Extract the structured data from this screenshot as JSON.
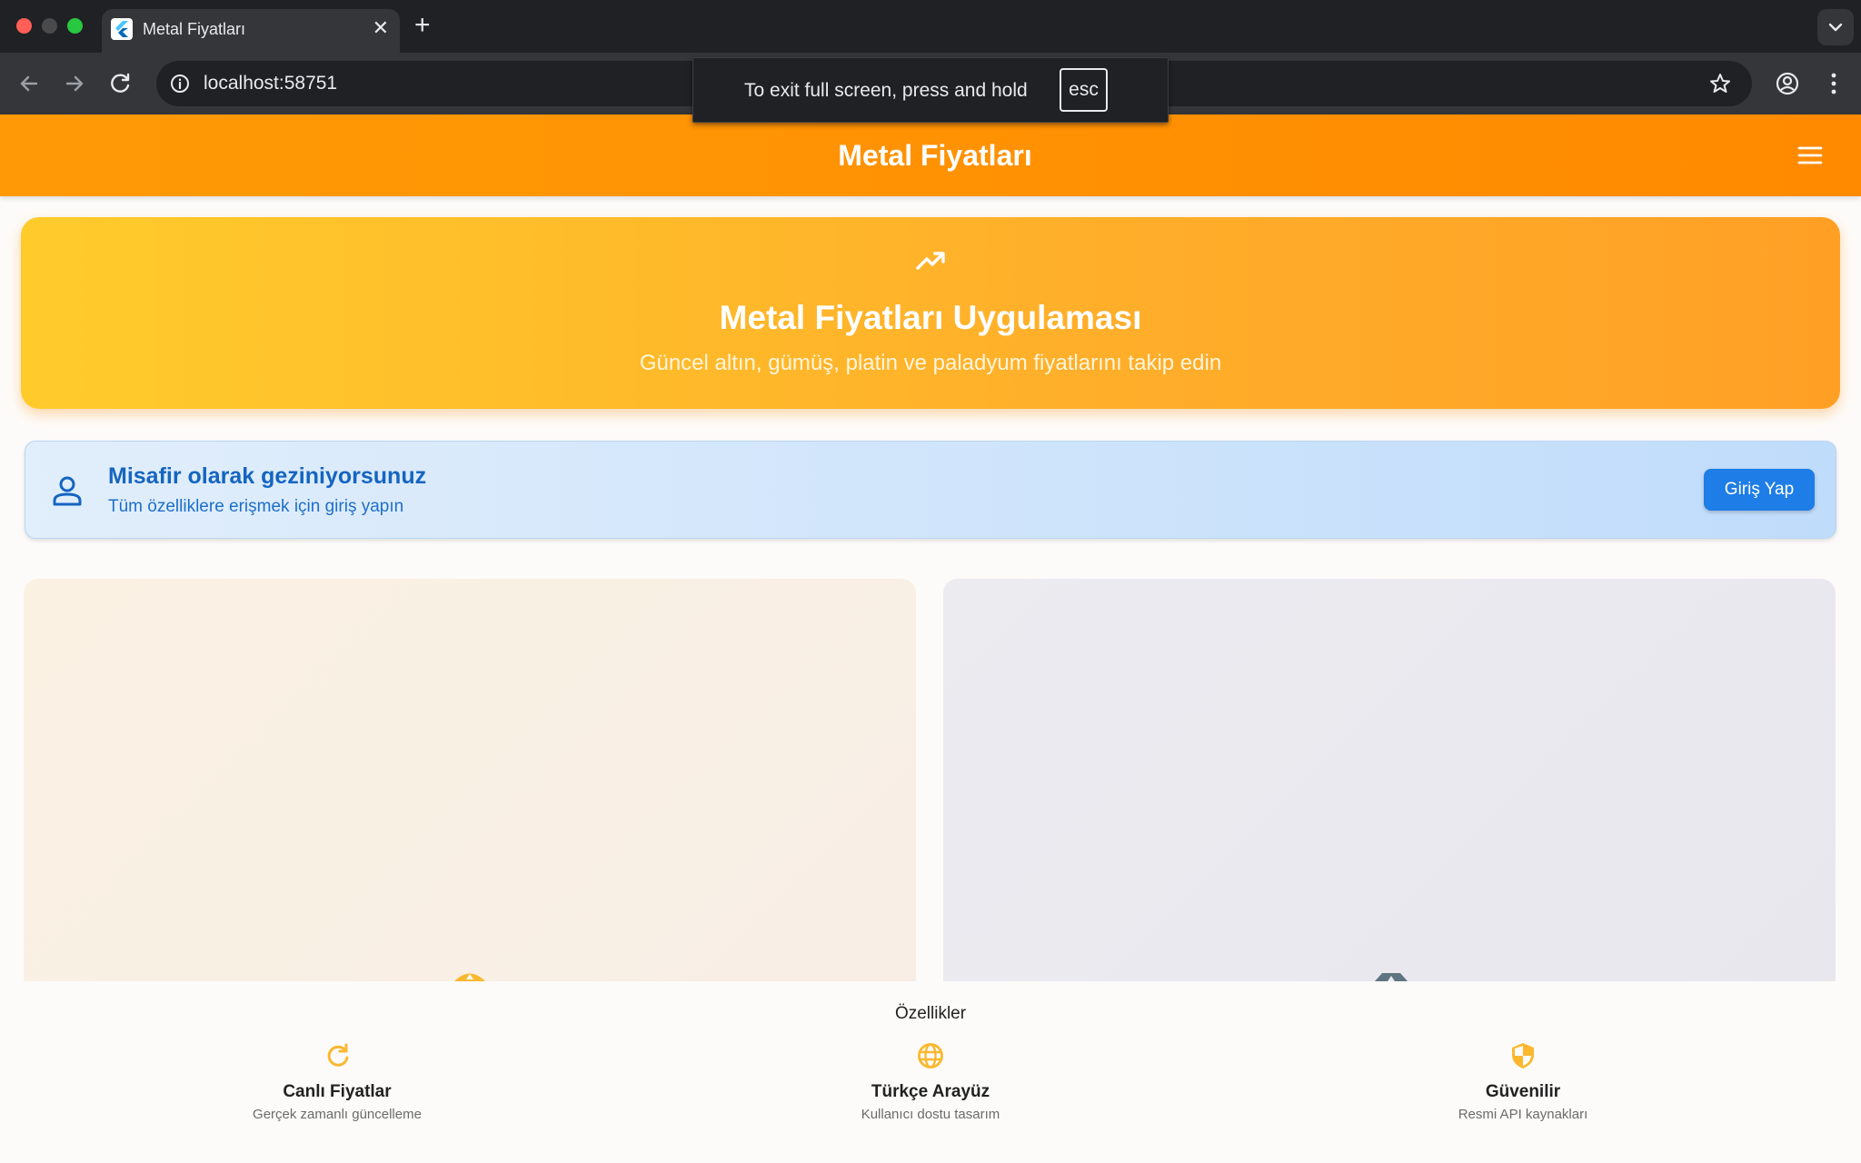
{
  "browser": {
    "tab_title": "Metal Fiyatları",
    "tab_close": "✕",
    "new_tab": "+",
    "url": "localhost:58751",
    "fullscreen_notice": "To exit full screen, press and hold",
    "fullscreen_key": "esc"
  },
  "appbar": {
    "title": "Metal Fiyatları"
  },
  "hero": {
    "title": "Metal Fiyatları Uygulaması",
    "subtitle": "Güncel altın, gümüş, platin ve paladyum fiyatlarını takip edin"
  },
  "guest": {
    "title": "Misafir olarak geziniyorsunuz",
    "subtitle": "Tüm özelliklere erişmek için giriş yapın",
    "login_label": "Giriş Yap"
  },
  "features": {
    "heading": "Özellikler",
    "items": [
      {
        "icon": "refresh-icon",
        "title": "Canlı Fiyatlar",
        "subtitle": "Gerçek zamanlı güncelleme"
      },
      {
        "icon": "globe-icon",
        "title": "Türkçe Arayüz",
        "subtitle": "Kullanıcı dostu tasarım"
      },
      {
        "icon": "shield-icon",
        "title": "Güvenilir",
        "subtitle": "Resmi API kaynakları"
      }
    ]
  },
  "colors": {
    "appbar": "#ff8f00",
    "accent": "#fbb82f",
    "guest_blue": "#1565c0",
    "login_button": "#1e7de6"
  }
}
